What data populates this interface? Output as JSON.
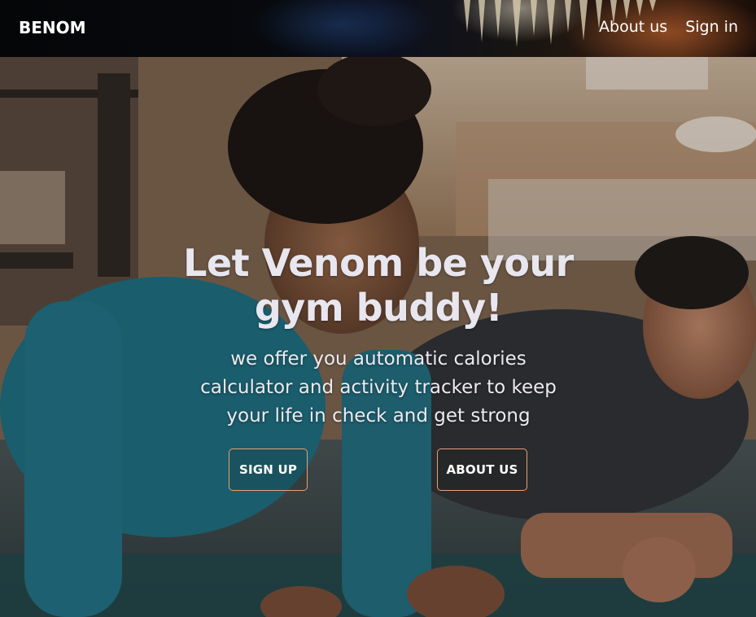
{
  "navbar": {
    "brand": "BENOM",
    "links": [
      {
        "label": "About us"
      },
      {
        "label": "Sign in"
      }
    ]
  },
  "hero": {
    "headline": "Let Venom be your gym buddy!",
    "subline": "we offer you automatic calories calculator and activity tracker to keep your life in check and get strong",
    "buttons": {
      "signup": "SIGN UP",
      "about": "ABOUT US"
    }
  },
  "colors": {
    "button_border": "#e8a07a",
    "headline": "#e8e6ee",
    "navbar_bg": "#07090d"
  }
}
